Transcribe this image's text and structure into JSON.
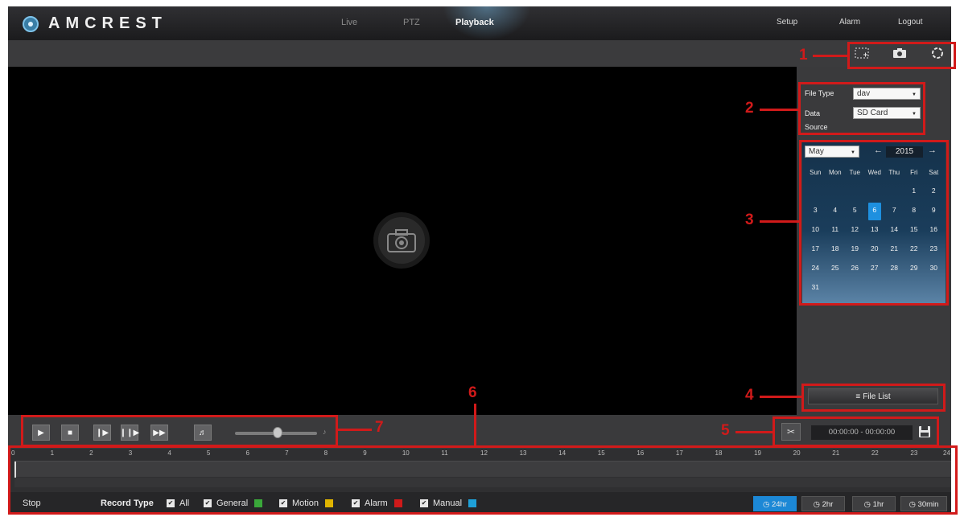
{
  "header": {
    "brand": "AMCREST",
    "nav": [
      {
        "label": "Live"
      },
      {
        "label": "PTZ"
      },
      {
        "label": "Playback",
        "active": true
      }
    ],
    "right_nav": [
      "Setup",
      "Alarm",
      "Logout"
    ]
  },
  "toolstrip": {
    "icons": [
      "zoom-region-icon",
      "snapshot-icon",
      "fullscreen-icon"
    ]
  },
  "right_panel": {
    "file_type_label": "File Type",
    "file_type_value": "dav",
    "data_label": "Data",
    "source_label": "Source",
    "data_source_value": "SD Card",
    "calendar": {
      "month": "May",
      "year": "2015",
      "weekdays": [
        "Sun",
        "Mon",
        "Tue",
        "Wed",
        "Thu",
        "Fri",
        "Sat"
      ],
      "weeks": [
        [
          "",
          "",
          "",
          "",
          "",
          "1",
          "2"
        ],
        [
          "3",
          "4",
          "5",
          "6",
          "7",
          "8",
          "9"
        ],
        [
          "10",
          "11",
          "12",
          "13",
          "14",
          "15",
          "16"
        ],
        [
          "17",
          "18",
          "19",
          "20",
          "21",
          "22",
          "23"
        ],
        [
          "24",
          "25",
          "26",
          "27",
          "28",
          "29",
          "30"
        ],
        [
          "31",
          "",
          "",
          "",
          "",
          "",
          ""
        ]
      ],
      "selected_day": "6"
    },
    "file_list_label": "File List"
  },
  "controls": {
    "buttons": [
      "play-icon",
      "stop-icon",
      "next-frame-icon",
      "slow-play-icon",
      "fast-play-icon"
    ],
    "volume_level": 0.55,
    "clip_range": "00:00:00 - 00:00:00"
  },
  "timeline": {
    "hours": [
      "0",
      "1",
      "2",
      "3",
      "4",
      "5",
      "6",
      "7",
      "8",
      "9",
      "10",
      "11",
      "12",
      "13",
      "14",
      "15",
      "16",
      "17",
      "18",
      "19",
      "20",
      "21",
      "22",
      "23",
      "24"
    ],
    "status": "Stop",
    "record_type_label": "Record Type",
    "record_types": [
      {
        "label": "All",
        "color": ""
      },
      {
        "label": "General",
        "color": "#3aa83a"
      },
      {
        "label": "Motion",
        "color": "#e0b400"
      },
      {
        "label": "Alarm",
        "color": "#d01a1a"
      },
      {
        "label": "Manual",
        "color": "#1ea0d8"
      }
    ],
    "zoom_options": [
      {
        "label": "24hr",
        "active": true
      },
      {
        "label": "2hr",
        "active": false
      },
      {
        "label": "1hr",
        "active": false
      },
      {
        "label": "30min",
        "active": false
      }
    ]
  },
  "annotations": [
    "1",
    "2",
    "3",
    "4",
    "5",
    "6",
    "7"
  ],
  "colors": {
    "accent": "#1e90df",
    "annotation": "#d11a1a"
  }
}
